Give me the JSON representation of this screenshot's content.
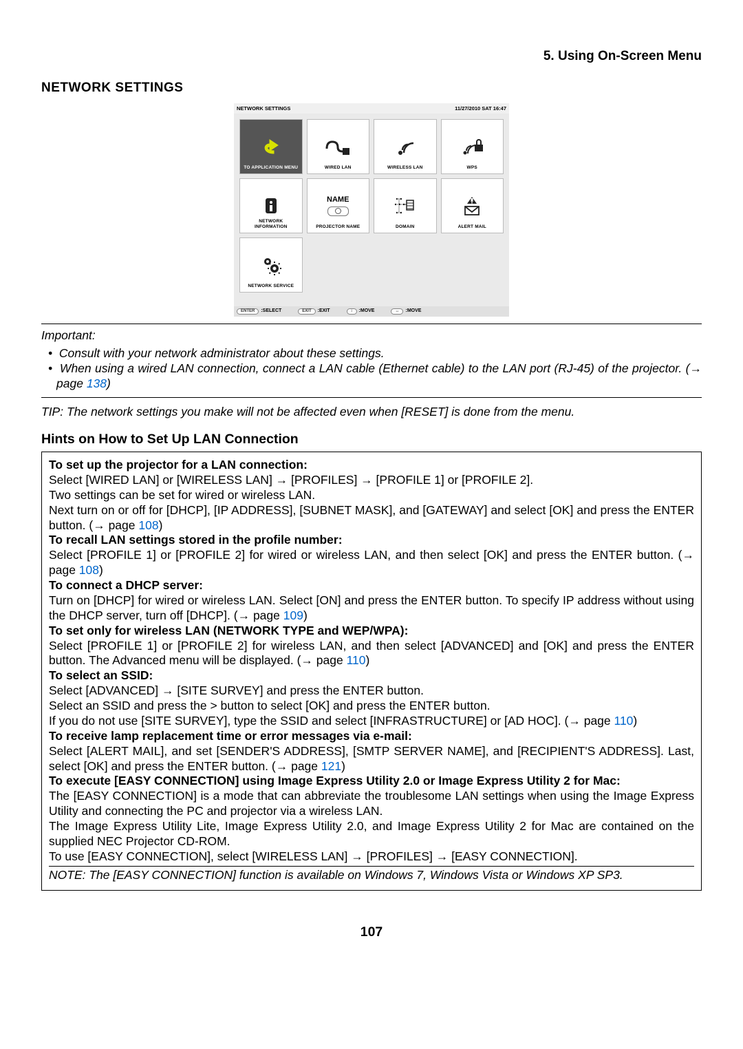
{
  "chapter_title": "5. Using On-Screen Menu",
  "section_title": "NETWORK SETTINGS",
  "ns_window": {
    "title": "NETWORK SETTINGS",
    "datetime": "11/27/2010 SAT 16:47",
    "tiles": [
      {
        "label": "TO APPLICATION MENU",
        "selected": true,
        "icon": "back-arrow"
      },
      {
        "label": "WIRED LAN",
        "icon": "cable"
      },
      {
        "label": "WIRELESS LAN",
        "icon": "wifi"
      },
      {
        "label": "WPS",
        "icon": "wifi-lock"
      },
      {
        "label": "NETWORK\nINFORMATION",
        "icon": "info"
      },
      {
        "label": "PROJECTOR NAME",
        "icon": "name"
      },
      {
        "label": "DOMAIN",
        "icon": "domain"
      },
      {
        "label": "ALERT MAIL",
        "icon": "mail-alert"
      },
      {
        "label": "NETWORK SERVICE",
        "icon": "gears"
      }
    ],
    "footer": [
      {
        "key": "ENTER",
        "val": ":SELECT"
      },
      {
        "key": "EXIT",
        "val": ":EXIT"
      },
      {
        "key": "↕",
        "val": ":MOVE"
      },
      {
        "key": "↔",
        "val": ":MOVE"
      }
    ]
  },
  "important": {
    "label": "Important:",
    "items": [
      "Consult with your network administrator about these settings.",
      "When using a wired LAN connection, connect a LAN cable (Ethernet cable) to the LAN port (RJ-45) of the projector. (→ page"
    ],
    "pageref": "138",
    "close_paren": ")"
  },
  "tip": "TIP: The network settings you make will not be affected even when [RESET] is done from the menu.",
  "hints_heading": "Hints on How to Set Up LAN Connection",
  "box": {
    "h1": "To set up the projector for a LAN connection:",
    "p1a": "Select [WIRED LAN] or [WIRELESS LAN] → [PROFILES] → [PROFILE 1] or [PROFILE 2].",
    "p1b": "Two settings can be set for wired or wireless LAN.",
    "p1c_a": "Next turn on or off for [DHCP], [IP ADDRESS], [SUBNET MASK], and [GATEWAY] and select [OK] and press the ENTER button. (→ page ",
    "p1c_ref": "108",
    "p1c_b": ")",
    "h2": "To recall LAN settings stored in the profile number:",
    "p2a": "Select [PROFILE 1] or [PROFILE 2] for wired or wireless LAN, and then select [OK] and press the ENTER button. (→ page ",
    "p2ref": "108",
    "p2b": ")",
    "h3": "To connect a DHCP server:",
    "p3a": "Turn on [DHCP] for wired or wireless LAN. Select [ON] and press the ENTER button. To specify IP address without using the DHCP server, turn off [DHCP]. (→ page ",
    "p3ref": "109",
    "p3b": ")",
    "h4": "To set only for wireless LAN (NETWORK TYPE and WEP/WPA):",
    "p4a": "Select [PROFILE 1] or [PROFILE 2] for wireless LAN, and then select [ADVANCED] and [OK] and press the ENTER button. The Advanced menu will be displayed. (→ page ",
    "p4ref": "110",
    "p4b": ")",
    "h5": "To select an SSID:",
    "p5a": "Select [ADVANCED] → [SITE SURVEY] and press the ENTER button.",
    "p5b": "Select an SSID and press the > button to select [OK] and press the ENTER button.",
    "p5c_a": "If you do not use [SITE SURVEY], type the SSID and select [INFRASTRUCTURE] or [AD HOC]. (→ page ",
    "p5c_ref": "110",
    "p5c_b": ")",
    "h6": "To receive lamp replacement time or error messages via e-mail:",
    "p6a": "Select [ALERT MAIL], and set [SENDER'S ADDRESS], [SMTP SERVER NAME], and [RECIPIENT'S ADDRESS]. Last, select [OK] and press the ENTER button. (→ page ",
    "p6ref": "121",
    "p6b": ")",
    "h7": "To execute [EASY CONNECTION] using Image Express Utility 2.0 or Image Express Utility 2 for Mac:",
    "p7a": "The [EASY CONNECTION] is a mode that can abbreviate the troublesome LAN settings when using the Image Express Utility and connecting the PC and projector via a wireless LAN.",
    "p7b": "The Image Express Utility Lite, Image Express Utility 2.0, and Image Express Utility 2 for Mac are contained on the supplied NEC Projector CD-ROM.",
    "p7c": "To use [EASY CONNECTION], select [WIRELESS LAN] → [PROFILES] → [EASY CONNECTION].",
    "note": "NOTE: The [EASY CONNECTION] function is available on Windows 7, Windows Vista or Windows XP SP3."
  },
  "page_number": "107"
}
